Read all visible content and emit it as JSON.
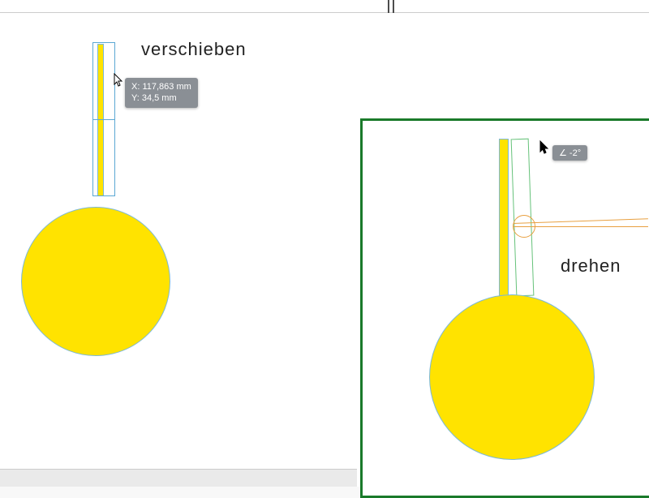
{
  "labels": {
    "verschieben": "verschieben",
    "drehen": "drehen"
  },
  "tooltip_xy": {
    "line1_prefix": "X: ",
    "line1_value": "117,863 mm",
    "line2_prefix": "Y: ",
    "line2_value": "34,5 mm"
  },
  "tooltip_angle": {
    "prefix": "∠ ",
    "value": "-2°"
  },
  "colors": {
    "shape_fill": "#ffe300",
    "shape_stroke": "#7bb8d8",
    "panel_border": "#1a7a2a",
    "tooltip_bg": "#8a8f95",
    "pivot": "#e8a040"
  }
}
